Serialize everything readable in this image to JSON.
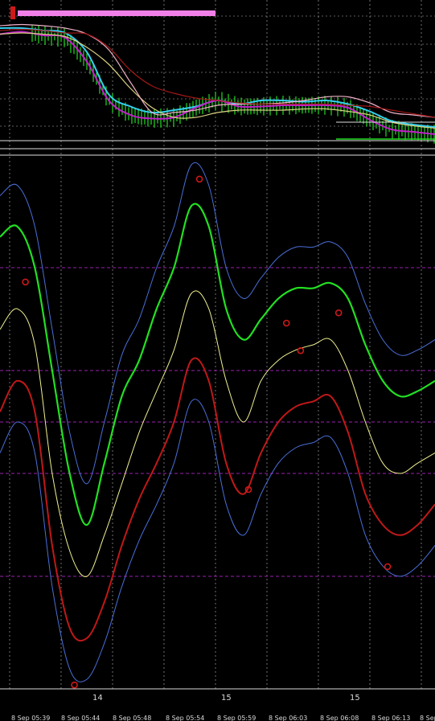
{
  "colors": {
    "background": "#000000",
    "grid": "#b8b8b8",
    "level_line": "#9a1fb0",
    "frame": "#e0e0e0",
    "price_bar": "#22dd22",
    "ma_cyan": "#34d0f0",
    "ma_magenta": "#c020c8",
    "ma_blue": "#1a5fd8",
    "ma_pink": "#f0b0c8",
    "ma_khaki": "#d8d080",
    "ma_darkred": "#a01818",
    "ma_yellow": "#e4e06a",
    "osc_green": "#22e022",
    "osc_red": "#c01818",
    "band_blue": "#4a6fd8",
    "osc_mid_yellow": "#f0f090",
    "marker": "#d01818",
    "bar_magenta": "#f080e8"
  },
  "icons": {
    "price_marker": "red-flag-icon",
    "cross_marker": "red-circle-marker-icon"
  },
  "axis": {
    "cycle_labels": [
      "14",
      "15",
      "15"
    ],
    "date_labels": [
      "8 Sep 05:39",
      "8 Sep 05:44",
      "8 Sep 05:48",
      "8 Sep 05:54",
      "8 Sep 05:59",
      "8 Sep 06:03",
      "8 Sep 06:08",
      "8 Sep 06:13",
      "8 Sep"
    ]
  },
  "chart_data": [
    {
      "type": "line",
      "panel": "price",
      "x": [
        0,
        5,
        10,
        15,
        20,
        25,
        30,
        35,
        40,
        45,
        50,
        55,
        60,
        65,
        70,
        75,
        80,
        85,
        90,
        95,
        100
      ],
      "ylim": [
        0,
        1
      ],
      "series": [
        {
          "values": [
            0.9,
            0.9,
            0.88,
            0.86,
            0.7,
            0.35,
            0.25,
            0.2,
            0.22,
            0.25,
            0.3,
            0.27,
            0.3,
            0.3,
            0.29,
            0.3,
            0.27,
            0.21,
            0.13,
            0.1,
            0.08
          ]
        },
        {
          "values": [
            0.85,
            0.87,
            0.84,
            0.82,
            0.62,
            0.3,
            0.18,
            0.15,
            0.16,
            0.24,
            0.3,
            0.25,
            0.25,
            0.26,
            0.26,
            0.26,
            0.24,
            0.14,
            0.06,
            0.04,
            0.02
          ]
        },
        {
          "values": [
            0.85,
            0.86,
            0.85,
            0.83,
            0.74,
            0.6,
            0.4,
            0.24,
            0.16,
            0.16,
            0.2,
            0.22,
            0.22,
            0.22,
            0.23,
            0.23,
            0.21,
            0.18,
            0.12,
            0.09,
            0.07
          ]
        },
        {
          "values": [
            0.92,
            0.93,
            0.92,
            0.9,
            0.85,
            0.72,
            0.45,
            0.2,
            0.2,
            0.22,
            0.26,
            0.27,
            0.27,
            0.28,
            0.3,
            0.33,
            0.33,
            0.28,
            0.2,
            0.18,
            0.16
          ]
        },
        {
          "values": [
            0.88,
            0.89,
            0.88,
            0.86,
            0.85,
            0.74,
            0.55,
            0.42,
            0.36,
            0.32,
            0.3,
            0.28,
            0.27,
            0.27,
            0.27,
            0.27,
            0.26,
            0.25,
            0.22,
            0.19,
            0.16
          ]
        }
      ]
    },
    {
      "type": "line",
      "panel": "oscillator",
      "x": [
        0,
        4,
        8,
        12,
        16,
        20,
        24,
        28,
        32,
        36,
        40,
        44,
        48,
        52,
        56,
        60,
        64,
        68,
        72,
        76,
        80,
        84,
        88,
        92,
        96,
        100
      ],
      "ylim": [
        0,
        100
      ],
      "levels": [
        80,
        60,
        50,
        40,
        20
      ],
      "series": [
        {
          "values": [
            72,
            78,
            60,
            20,
            2,
            3,
            20,
            45,
            48,
            65,
            72,
            98,
            90,
            42,
            40,
            65,
            70,
            67,
            68,
            72,
            50,
            28,
            25,
            33,
            40,
            45
          ]
        },
        {
          "values": [
            70,
            77,
            62,
            22,
            3,
            4,
            19,
            43,
            47,
            63,
            71,
            97,
            88,
            43,
            41,
            63,
            69,
            66,
            67,
            71,
            51,
            30,
            24,
            31,
            38,
            44
          ]
        },
        {
          "values": [
            68,
            72,
            65,
            40,
            25,
            20,
            28,
            38,
            48,
            56,
            64,
            75,
            72,
            58,
            50,
            58,
            62,
            64,
            65,
            66,
            60,
            50,
            42,
            40,
            42,
            44
          ]
        },
        {
          "values": [
            86,
            88,
            80,
            60,
            40,
            30,
            42,
            55,
            62,
            72,
            80,
            92,
            88,
            72,
            66,
            70,
            74,
            76,
            76,
            77,
            74,
            65,
            58,
            55,
            56,
            58
          ]
        },
        {
          "values": [
            52,
            58,
            52,
            26,
            10,
            8,
            15,
            26,
            35,
            42,
            50,
            62,
            58,
            42,
            36,
            44,
            50,
            53,
            54,
            55,
            48,
            36,
            30,
            28,
            30,
            34
          ]
        }
      ]
    }
  ]
}
